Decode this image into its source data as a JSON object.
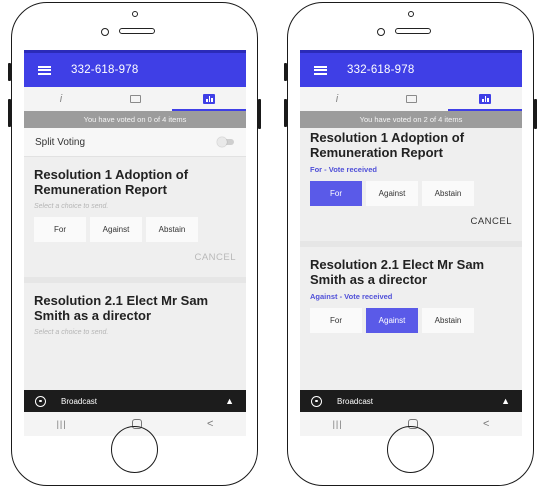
{
  "app": {
    "title": "332-618-978",
    "tabs": [
      {
        "icon": "info-icon",
        "glyph": "i"
      },
      {
        "icon": "chat-icon"
      },
      {
        "icon": "chart-icon",
        "active": true
      }
    ],
    "broadcast_label": "Broadcast",
    "accent_color": "#3f3fe6"
  },
  "screens": [
    {
      "voted_status": "You have voted on 0 of 4 items",
      "split_voting_label": "Split Voting",
      "resolutions": [
        {
          "title": "Resolution 1 Adoption of Remuneration Report",
          "hint": "Select a choice to send.",
          "choices": [
            "For",
            "Against",
            "Abstain"
          ],
          "selected": null,
          "cancel_label": "CANCEL"
        },
        {
          "title": "Resolution 2.1 Elect Mr Sam Smith as a director",
          "hint": "Select a choice to send."
        }
      ]
    },
    {
      "voted_status": "You have voted on 2 of 4 items",
      "resolutions": [
        {
          "title": "Resolution 1 Adoption of Remuneration Report",
          "status": "For - Vote received",
          "choices": [
            "For",
            "Against",
            "Abstain"
          ],
          "selected": "For",
          "cancel_label": "CANCEL"
        },
        {
          "title": "Resolution 2.1 Elect Mr Sam Smith as a director",
          "status": "Against - Vote received",
          "choices": [
            "For",
            "Against",
            "Abstain"
          ],
          "selected": "Against"
        }
      ]
    }
  ]
}
